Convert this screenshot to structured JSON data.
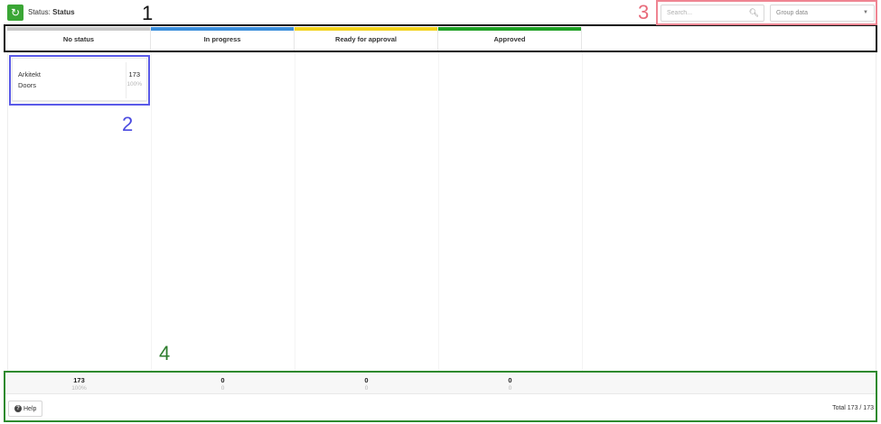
{
  "header": {
    "status_label": "Status:",
    "status_value": "Status",
    "refresh_icon": "refresh-icon"
  },
  "search": {
    "placeholder": "Search...",
    "icon": "search-icon"
  },
  "group": {
    "placeholder": "Group data",
    "icon": "chevron-down-icon"
  },
  "columns": [
    {
      "label": "No status",
      "color": "#c8c8c8"
    },
    {
      "label": "In progress",
      "color": "#3b8edb"
    },
    {
      "label": "Ready for approval",
      "color": "#f2d21b"
    },
    {
      "label": "Approved",
      "color": "#1ea024"
    }
  ],
  "card": {
    "line1": "Arkitekt",
    "line2": "Doors",
    "count": "173",
    "percent": "100%"
  },
  "footer": {
    "columns": [
      {
        "count": "173",
        "percent": "100%"
      },
      {
        "count": "0",
        "percent": "0"
      },
      {
        "count": "0",
        "percent": "0"
      },
      {
        "count": "0",
        "percent": "0"
      }
    ],
    "help_label": "Help",
    "total": "Total 173 / 173"
  },
  "annotations": [
    "1",
    "2",
    "3",
    "4"
  ]
}
